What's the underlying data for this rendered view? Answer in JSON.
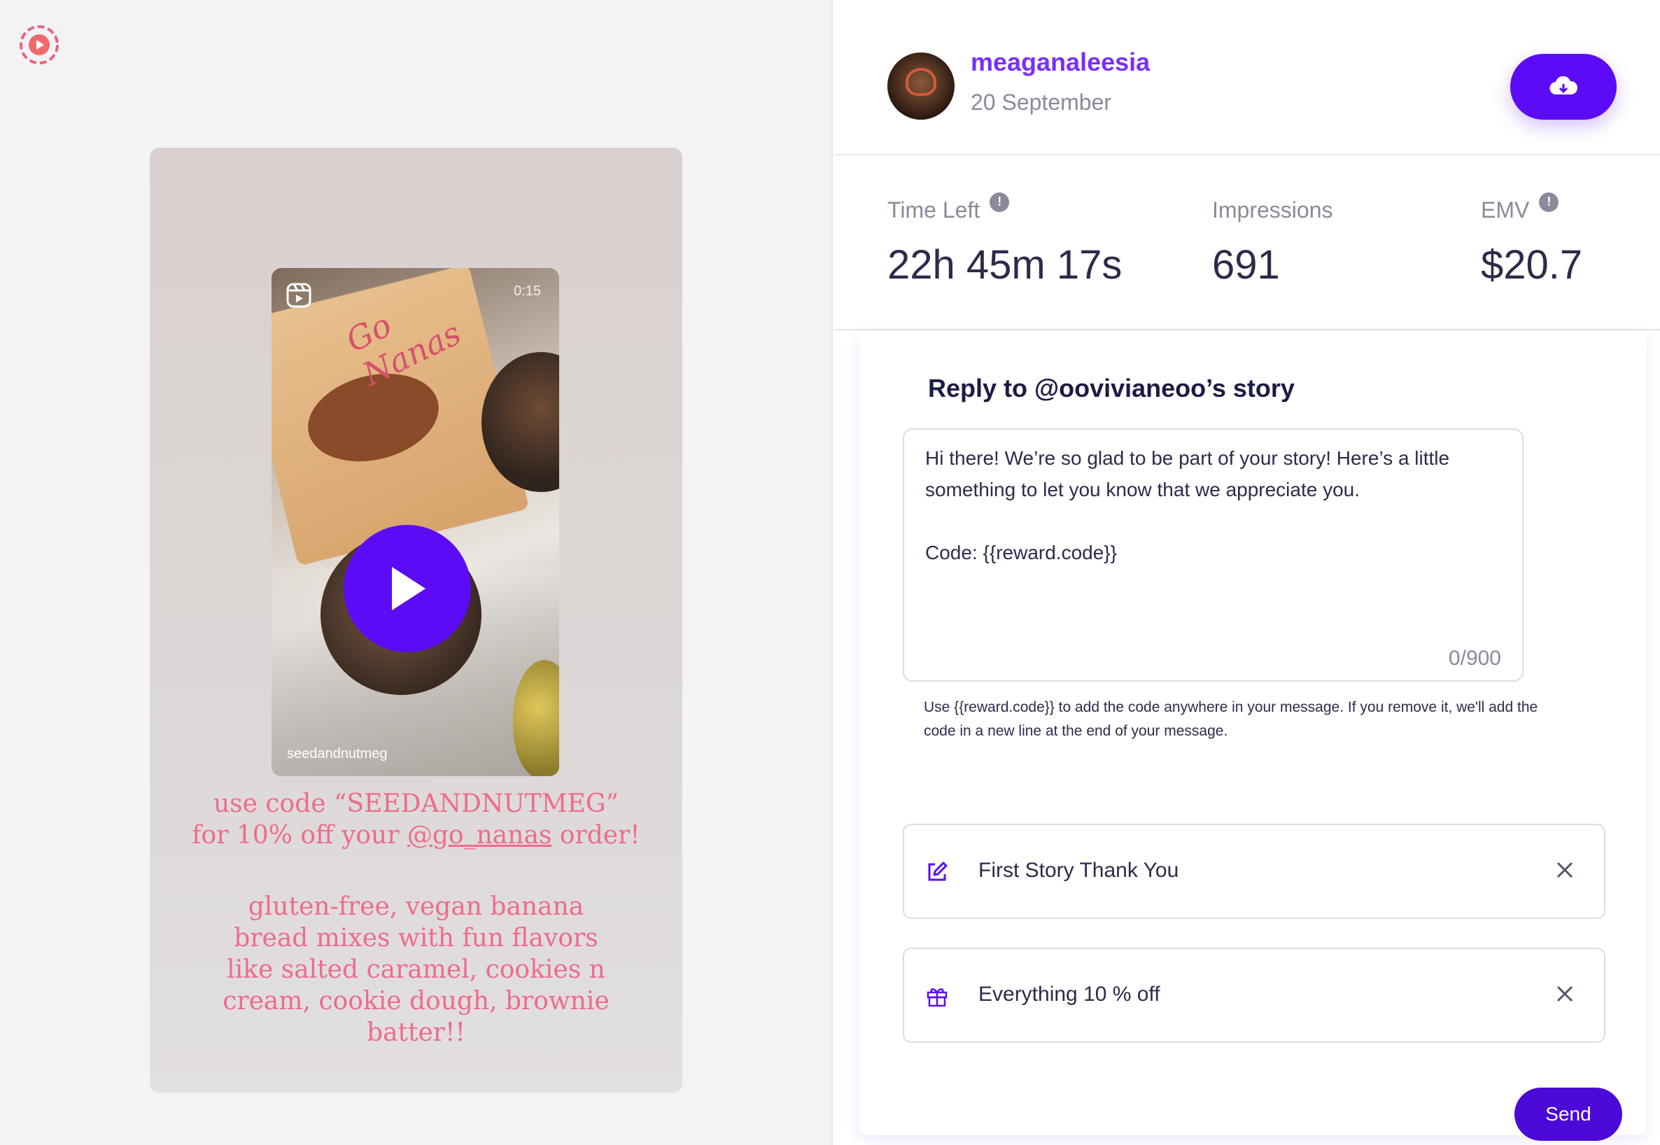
{
  "app": {
    "logo_icon": "story-logo-icon"
  },
  "story": {
    "reel_time": "0:15",
    "reel_handle": "seedandnutmeg",
    "reel_bag_title": "Go Nanas",
    "caption_line1": "use code “SEEDANDNUTMEG”",
    "caption_line2_prefix": "for 10% off your ",
    "caption_mention": "@go_nanas",
    "caption_line2_suffix": " order!",
    "description": "gluten-free, vegan banana bread mixes with fun flavors like salted caramel, cookies n cream, cookie dough, brownie batter!!"
  },
  "header": {
    "username": "meaganaleesia",
    "date": "20 September",
    "download_icon": "cloud-download-icon"
  },
  "stats": {
    "time_left": {
      "label": "Time Left",
      "value": "22h 45m 17s"
    },
    "impressions": {
      "label": "Impressions",
      "value": "691"
    },
    "emv": {
      "label": "EMV",
      "value": "$20.7"
    }
  },
  "reply": {
    "title": "Reply to @oovivianeoo’s story",
    "message": "Hi there! We’re so glad to be part of your story! Here’s a little something to let you know that we appreciate you.\n\nCode: {{reward.code}}",
    "char_count": "0/900",
    "helper": "Use {{reward.code}} to add the code anywhere in your message. If you remove it, we'll add the code in a new line at the end of your message.",
    "options": [
      {
        "label": "First Story Thank You",
        "icon": "edit-icon"
      },
      {
        "label": "Everything 10 % off",
        "icon": "gift-icon"
      }
    ],
    "send_label": "Send"
  },
  "colors": {
    "accent": "#5b0cf5",
    "username": "#7b2ff7",
    "story_text": "#ee6b8c"
  }
}
